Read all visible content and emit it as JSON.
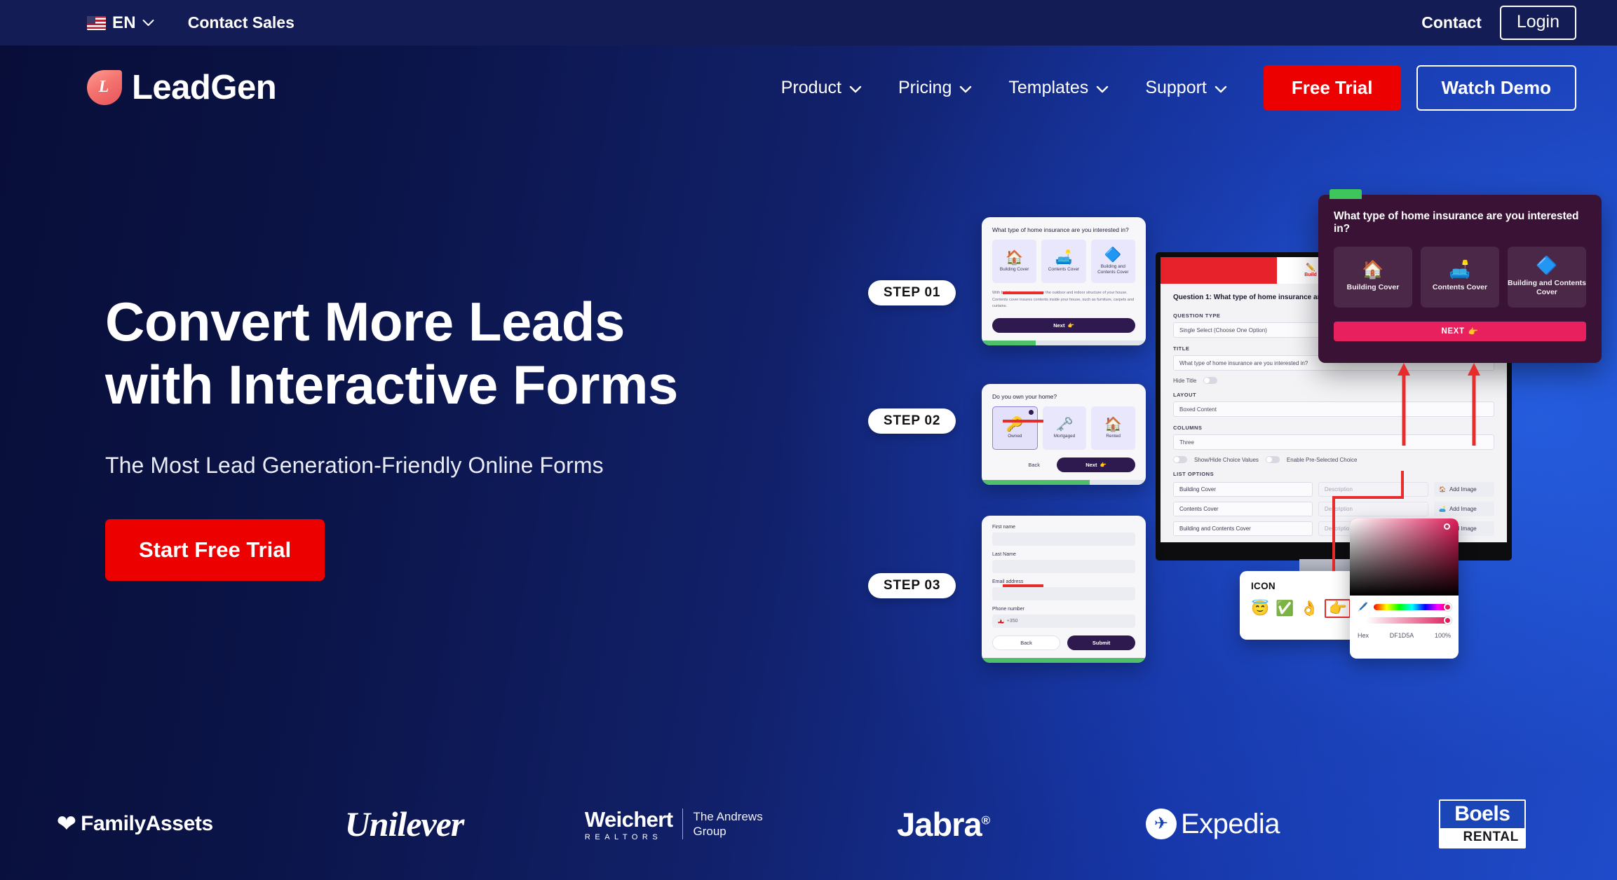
{
  "topbar": {
    "flag_icon": "us-flag-icon",
    "language": "EN",
    "contact_sales": "Contact Sales",
    "contact": "Contact",
    "login": "Login"
  },
  "header": {
    "logo_mark_letter": "L",
    "logo_text": "LeadGen",
    "nav": [
      {
        "label": "Product",
        "has_dropdown": true
      },
      {
        "label": "Pricing",
        "has_dropdown": true
      },
      {
        "label": "Templates",
        "has_dropdown": true
      },
      {
        "label": "Support",
        "has_dropdown": true
      }
    ],
    "free_trial": "Free Trial",
    "watch_demo": "Watch Demo"
  },
  "hero": {
    "title": "Convert More Leads\nwith Interactive Forms",
    "subtitle": "The Most Lead Generation-Friendly Online Forms",
    "cta": "Start Free Trial"
  },
  "illustration": {
    "steps": [
      {
        "pill": "STEP 01"
      },
      {
        "pill": "STEP 02"
      },
      {
        "pill": "STEP 03"
      }
    ],
    "step1_card": {
      "question": "What type of home insurance are you interested in?",
      "options": [
        {
          "label": "Building Cover",
          "icon": "house-icon"
        },
        {
          "label": "Contents Cover",
          "icon": "sofa-icon"
        },
        {
          "label": "Building and Contents Cover",
          "icon": "diamond-icon"
        }
      ],
      "description": "With building cover you insure the outdoor and indoor structure of your house. Contents cover insures contents inside your house, such as furniture, carpets and curtains.",
      "next": "Next",
      "next_icon": "pointing-right-icon",
      "progress": 33
    },
    "step2_card": {
      "question": "Do you own your home?",
      "options": [
        {
          "label": "Owned",
          "icon": "key-icon",
          "selected": true
        },
        {
          "label": "Mortgaged",
          "icon": "key-money-icon",
          "selected": false
        },
        {
          "label": "Rented",
          "icon": "house-icon",
          "selected": false
        }
      ],
      "back": "Back",
      "next": "Next",
      "next_icon": "pointing-right-icon",
      "progress": 66
    },
    "step3_card": {
      "fields": [
        {
          "label": "First name",
          "value": ""
        },
        {
          "label": "Last Name",
          "value": ""
        },
        {
          "label": "Email address",
          "value": ""
        },
        {
          "label": "Phone number",
          "value": "+350",
          "has_flag": true
        }
      ],
      "back": "Back",
      "submit": "Submit",
      "progress": 100
    },
    "builder": {
      "tab_label": "Build",
      "tab_icon": "pencil-icon",
      "question_heading": "Question 1: What type of home insurance are you interested in?",
      "question_type_label": "QUESTION TYPE",
      "question_type_value": "Single Select (Choose One Option)",
      "title_label": "TITLE",
      "title_value": "What type of home insurance are you interested in?",
      "hide_title_label": "Hide Title",
      "layout_label": "LAYOUT",
      "layout_value": "Boxed Content",
      "columns_label": "COLUMNS",
      "columns_value": "Three",
      "toggle_show_hide": "Show/Hide Choice Values",
      "toggle_preselect": "Enable Pre-Selected Choice",
      "list_options_label": "LIST OPTIONS",
      "options": [
        {
          "name": "Building Cover",
          "description_placeholder": "Description",
          "add_image": "Add Image",
          "image_icon": "house-icon"
        },
        {
          "name": "Contents Cover",
          "description_placeholder": "Description",
          "add_image": "Add Image",
          "image_icon": "sofa-icon"
        },
        {
          "name": "Building and Contents Cover",
          "description_placeholder": "Description",
          "add_image": "Add Image",
          "image_icon": "diamond-icon"
        }
      ]
    },
    "preview_card": {
      "title": "What type of home insurance are you interested in?",
      "options": [
        {
          "label": "Building Cover",
          "icon": "house-icon"
        },
        {
          "label": "Contents Cover",
          "icon": "sofa-icon"
        },
        {
          "label": "Building and Contents Cover",
          "icon": "diamond-icon"
        }
      ],
      "next": "NEXT",
      "next_icon": "pointing-right-icon",
      "accent_color": "#e8205e"
    },
    "icon_picker": {
      "title": "ICON",
      "icons": [
        {
          "glyph": "😇",
          "name": "angel-face-icon",
          "selected": false
        },
        {
          "glyph": "✅",
          "name": "check-mark-icon",
          "selected": false
        },
        {
          "glyph": "👌",
          "name": "ok-hand-icon",
          "selected": false
        },
        {
          "glyph": "👉",
          "name": "pointing-right-icon",
          "selected": true
        }
      ]
    },
    "color_picker": {
      "format": "Hex",
      "hex_value": "DF1D5A",
      "opacity": "100%",
      "swatch_color": "#DF1D5A"
    }
  },
  "brands": [
    {
      "name": "FamilyAssets",
      "id": "familyassets-logo"
    },
    {
      "name": "Unilever",
      "id": "unilever-logo"
    },
    {
      "name": "Weichert",
      "sub": "REALTORS",
      "side1": "The Andrews",
      "side2": "Group",
      "id": "weichert-logo"
    },
    {
      "name": "Jabra",
      "mark": "®",
      "id": "jabra-logo"
    },
    {
      "name": "Expedia",
      "id": "expedia-logo"
    },
    {
      "name": "Boels",
      "sub": "RENTAL",
      "id": "boels-logo"
    }
  ]
}
